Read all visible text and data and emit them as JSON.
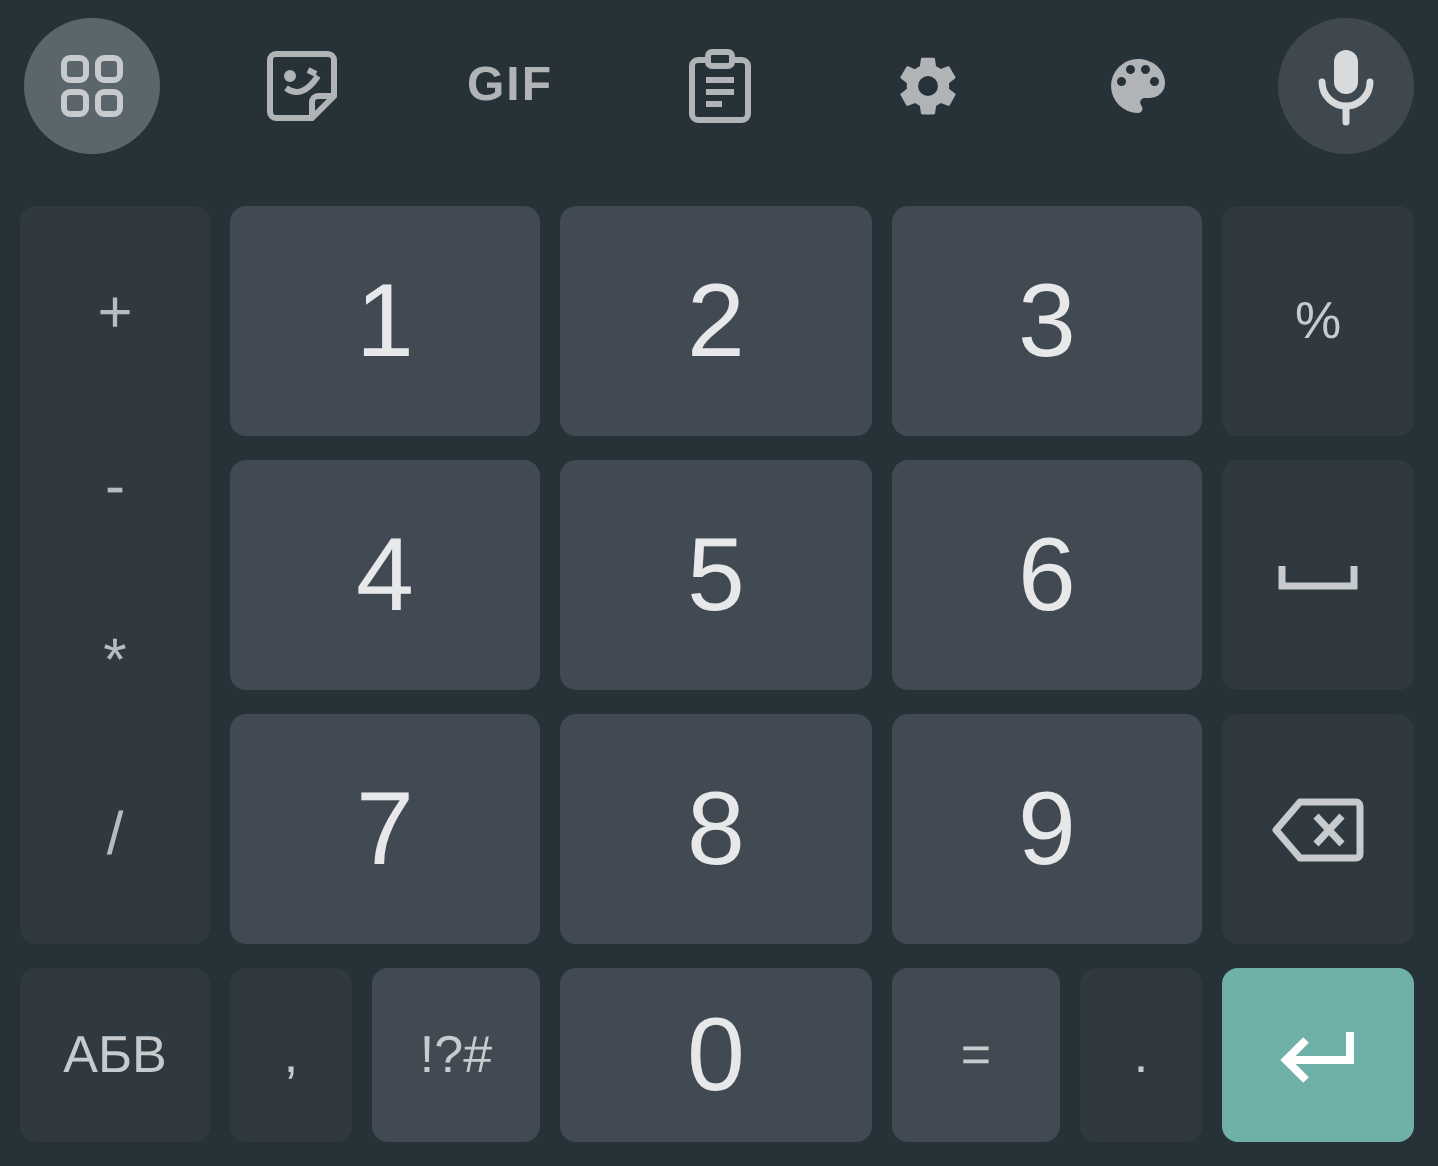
{
  "toolbar": [
    {
      "kind": "apps",
      "selected": true
    },
    {
      "kind": "sticker",
      "selected": false
    },
    {
      "kind": "gif",
      "label": "GIF",
      "selected": false
    },
    {
      "kind": "clipboard",
      "selected": false
    },
    {
      "kind": "settings",
      "selected": false
    },
    {
      "kind": "theme",
      "selected": false
    },
    {
      "kind": "mic",
      "selected": false
    }
  ],
  "operators": [
    "+",
    "-",
    "*",
    "/"
  ],
  "rows": [
    [
      {
        "kind": "digit",
        "label": "1"
      },
      {
        "kind": "digit",
        "label": "2"
      },
      {
        "kind": "digit",
        "label": "3"
      },
      {
        "kind": "dark",
        "label": "%"
      }
    ],
    [
      {
        "kind": "digit",
        "label": "4"
      },
      {
        "kind": "digit",
        "label": "5"
      },
      {
        "kind": "digit",
        "label": "6"
      },
      {
        "kind": "space"
      }
    ],
    [
      {
        "kind": "digit",
        "label": "7"
      },
      {
        "kind": "digit",
        "label": "8"
      },
      {
        "kind": "digit",
        "label": "9"
      },
      {
        "kind": "backspace"
      }
    ],
    [
      {
        "kind": "dark",
        "label": "АБВ"
      },
      {
        "kind": "dark",
        "label": ","
      },
      {
        "kind": "symbol",
        "label": "!?#"
      },
      {
        "kind": "digit",
        "label": "0"
      },
      {
        "kind": "symbol",
        "label": "="
      },
      {
        "kind": "dark",
        "label": "."
      },
      {
        "kind": "enter"
      }
    ]
  ]
}
